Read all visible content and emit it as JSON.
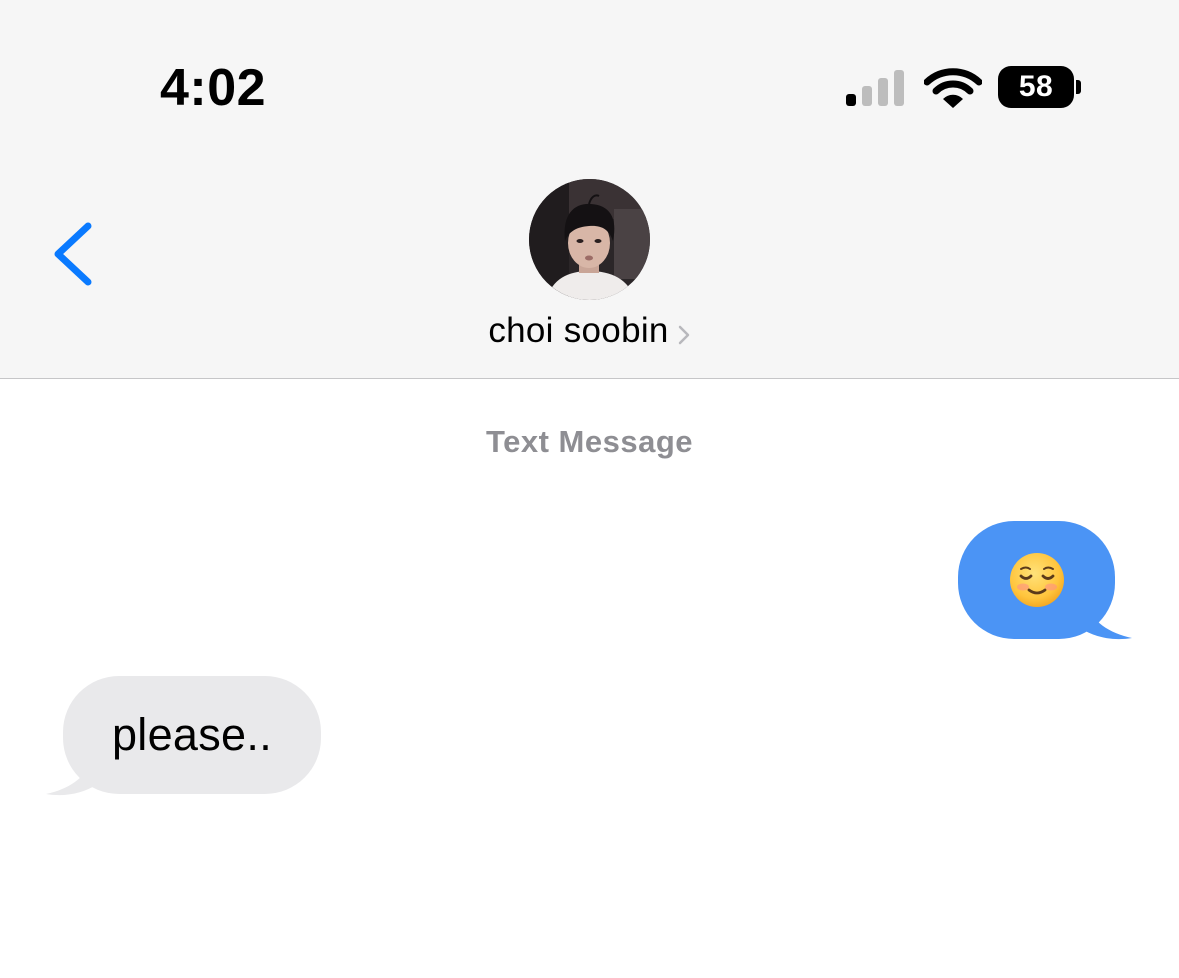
{
  "status_bar": {
    "time": "4:02",
    "signal_icon": "cellular-signal-icon",
    "signal_bars_active": 1,
    "signal_bars_total": 4,
    "wifi_icon": "wifi-icon",
    "battery_icon": "battery-icon",
    "battery_percent": "58"
  },
  "nav": {
    "back_icon": "chevron-left-icon",
    "contact_name": "choi soobin",
    "contact_chevron_icon": "chevron-right-icon",
    "avatar": "contact-avatar-photo"
  },
  "conversation": {
    "service_label": "Text Message",
    "messages": [
      {
        "direction": "outgoing",
        "content": "smiling-face-emoji"
      },
      {
        "direction": "incoming",
        "content": "please.."
      }
    ]
  },
  "colors": {
    "accent_blue": "#0a7aff",
    "outgoing_bubble": "#4b94f5",
    "incoming_bubble": "#e9e9eb",
    "header_background": "#f6f6f6",
    "secondary_text": "#8e8e93"
  }
}
